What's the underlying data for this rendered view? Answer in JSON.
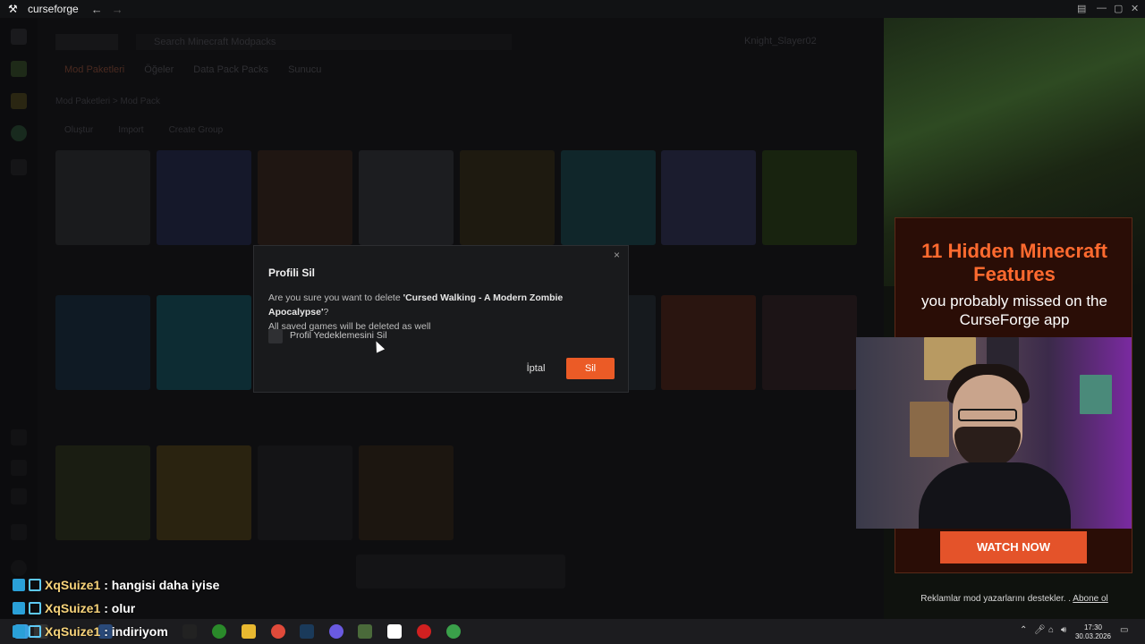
{
  "titlebar": {
    "app_name": "curseforge",
    "back": "←",
    "forward": "→"
  },
  "app_bg": {
    "search_placeholder": "Search Minecraft Modpacks",
    "user": "Knight_Slayer02",
    "tabs": [
      "Mod Paketleri",
      "Öğeler",
      "Data Pack Packs",
      "Sunucu"
    ],
    "breadcrumb": "Mod Paketleri  >  Mod Pack",
    "toolbar": [
      "Oluştur",
      "Import",
      "Create Group"
    ]
  },
  "dialog": {
    "title": "Profili Sil",
    "message_prefix": "Are you sure you want to delete ",
    "profile_name": "'Cursed Walking - A Modern Zombie Apocalypse'",
    "message_suffix": "?",
    "message_line2": "All saved games will be deleted as well",
    "checkbox_label": "Profil Yedeklemesini Sil",
    "cancel_label": "İptal",
    "delete_label": "Sil",
    "close_icon": "×"
  },
  "ad": {
    "title": "11 Hidden Minecraft Features",
    "subtitle": "you probably missed on the CurseForge app",
    "cta": "WATCH NOW",
    "footer": "Reklamlar mod yazarlarını destekler. .",
    "subscribe": "Abone ol"
  },
  "chat": [
    {
      "user": "XqSuize1",
      "message": ": hangisi daha iyise"
    },
    {
      "user": "XqSuize1",
      "message": ": olur"
    },
    {
      "user": "XqSuize1",
      "message": ": indiriyom"
    }
  ],
  "taskbar": {
    "time": "17:30",
    "date": "30.03.2026"
  },
  "colors": {
    "accent": "#eb5b26",
    "ad_title": "#ff6a2f",
    "modal_bg": "#191a1c"
  }
}
